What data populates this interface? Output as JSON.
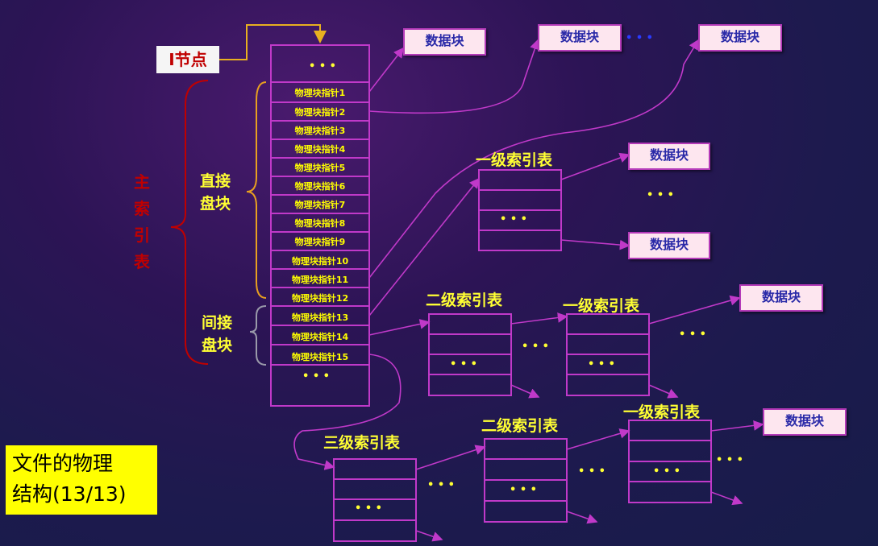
{
  "inode_label": "I节点",
  "main_index_label": [
    "主",
    "索",
    "引",
    "表"
  ],
  "direct_label": [
    "直接",
    "盘块"
  ],
  "indirect_label": [
    "间接",
    "盘块"
  ],
  "ellipsis": "• • •",
  "pointer_rows": [
    "物理块指针1",
    "物理块指针2",
    "物理块指针3",
    "物理块指针4",
    "物理块指针5",
    "物理块指针6",
    "物理块指针7",
    "物理块指针8",
    "物理块指针9",
    "物理块指针10",
    "物理块指针11",
    "物理块指针12",
    "物理块指针13",
    "物理块指针14",
    "物理块指针15"
  ],
  "data_block": "数据块",
  "level1_index": "一级索引表",
  "level2_index": "二级索引表",
  "level3_index": "三级索引表",
  "caption_line1": "文件的物理",
  "caption_line2": "结构(13/13)",
  "colors": {
    "accent_yellow": "#ffff00",
    "line_magenta": "#c039c9",
    "inode_red": "#c00000",
    "brace_orange": "#e8a020"
  }
}
